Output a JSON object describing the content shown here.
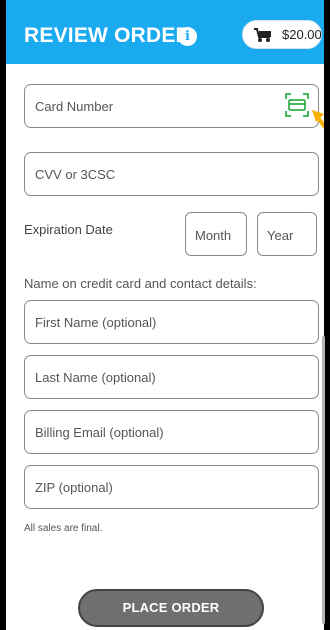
{
  "header": {
    "title": "REVIEW ORDER",
    "info_icon": "info-icon",
    "cart_icon": "shopping-cart-icon",
    "cart_total": "$20.00",
    "background_color": "#1aaaf0"
  },
  "form": {
    "card_number_placeholder": "Card Number",
    "scan_icon": "card-scan-icon",
    "cvv_placeholder": "CVV or 3CSC",
    "expiration_label": "Expiration Date",
    "month_placeholder": "Month",
    "year_placeholder": "Year",
    "contact_section_label": "Name on credit card and contact details:",
    "first_name_placeholder": "First Name (optional)",
    "last_name_placeholder": "Last Name (optional)",
    "billing_email_placeholder": "Billing Email (optional)",
    "zip_placeholder": "ZIP (optional)",
    "final_note": "All sales are final."
  },
  "actions": {
    "place_order_label": "PLACE ORDER"
  },
  "colors": {
    "accent": "#1aaaf0",
    "scan_icon": "#2fb04a",
    "pointer_arrow": "#f5b000",
    "button": "#6f6f6f"
  }
}
